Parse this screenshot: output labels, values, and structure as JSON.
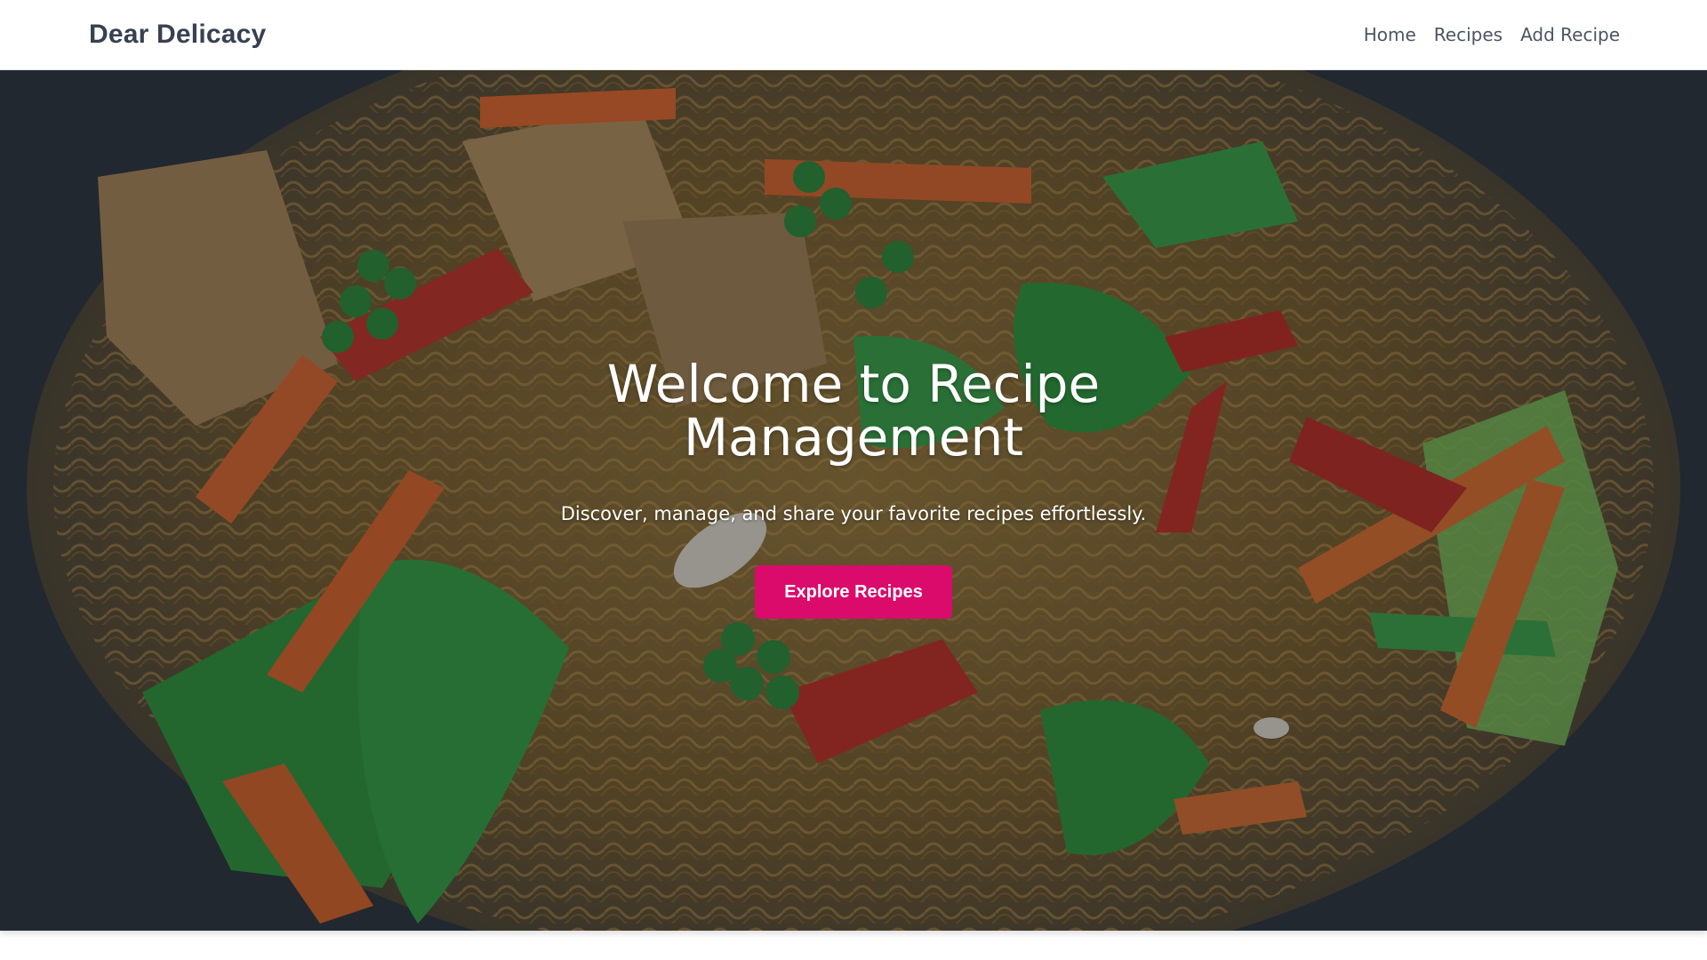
{
  "navbar": {
    "brand": "Dear Delicacy",
    "links": [
      {
        "label": "Home"
      },
      {
        "label": "Recipes"
      },
      {
        "label": "Add Recipe"
      }
    ]
  },
  "hero": {
    "title": "Welcome to Recipe Management",
    "subtitle": "Discover, manage, and share your favorite recipes effortlessly.",
    "cta_label": "Explore Recipes",
    "background_image": "stir-fried noodles with vegetables in a wok"
  },
  "colors": {
    "brand_text": "#374151",
    "nav_text": "#4b5563",
    "accent": "#db0b6b",
    "hero_bg": "#2b333b"
  }
}
